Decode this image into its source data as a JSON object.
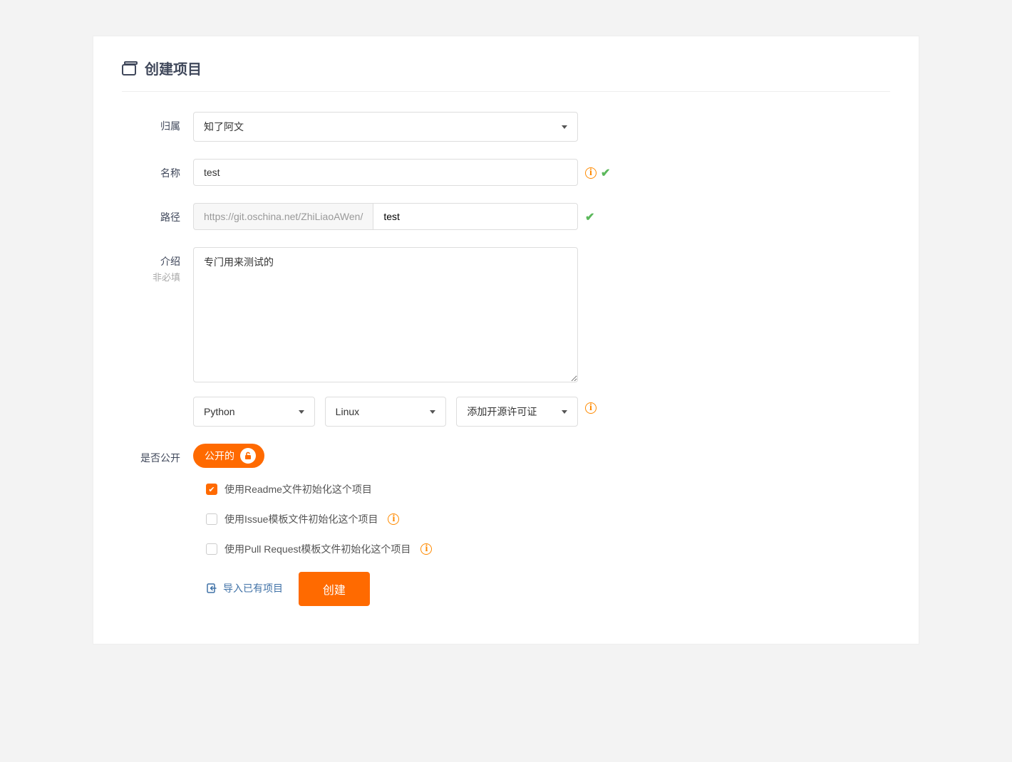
{
  "colors": {
    "accent": "#ff6a00",
    "success": "#5bb85b",
    "warning": "#ff8a00"
  },
  "page_title": "创建项目",
  "labels": {
    "owner": "归属",
    "name": "名称",
    "path": "路径",
    "intro": "介绍",
    "intro_sub": "非必填",
    "visibility": "是否公开"
  },
  "form": {
    "owner_value": "知了阿文",
    "name_value": "test",
    "path_prefix": "https://git.oschina.net/ZhiLiaoAWen/",
    "path_value": "test",
    "intro_value": "专门用来测试的",
    "language_value": "Python",
    "gitignore_value": "Linux",
    "license_value": "添加开源许可证"
  },
  "visibility": {
    "label": "公开的"
  },
  "checkboxes": {
    "readme": {
      "label": "使用Readme文件初始化这个项目",
      "checked": true
    },
    "issue": {
      "label": "使用Issue模板文件初始化这个项目",
      "checked": false
    },
    "pr": {
      "label": "使用Pull Request模板文件初始化这个项目",
      "checked": false
    }
  },
  "import_label": "导入已有项目",
  "submit_label": "创建"
}
